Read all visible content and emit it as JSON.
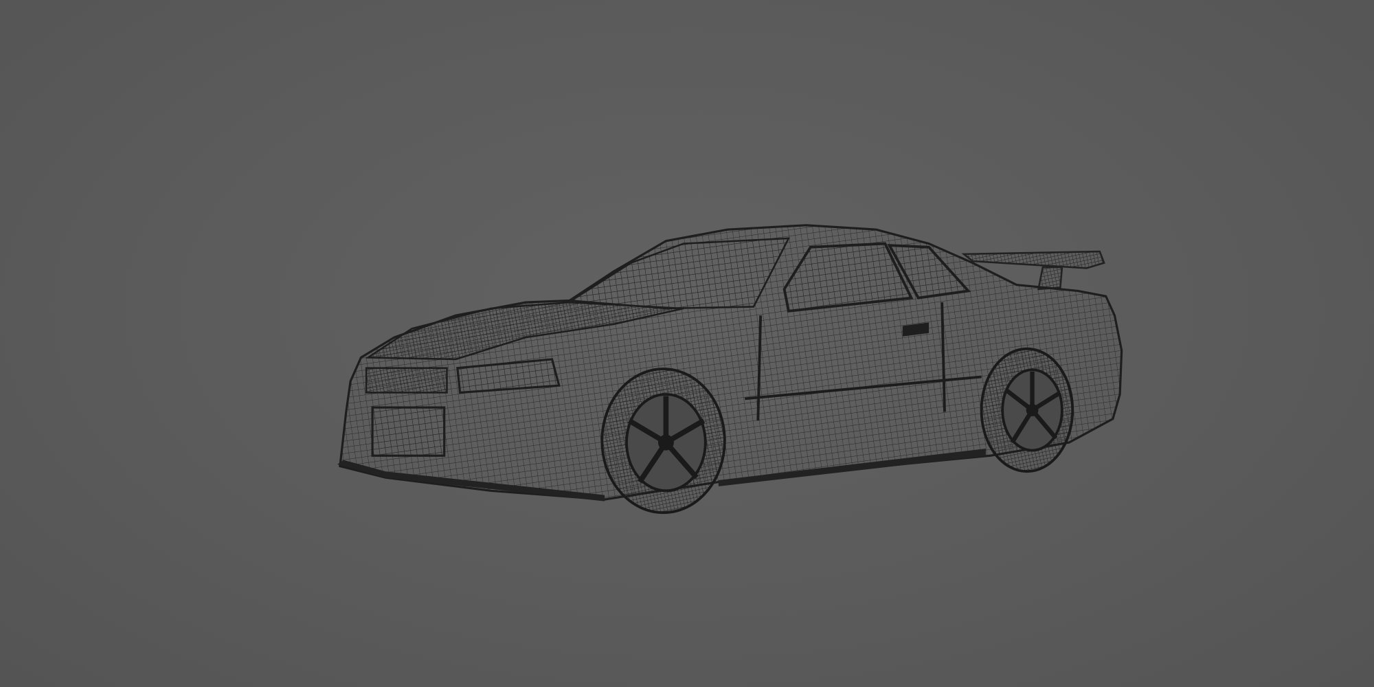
{
  "scene": {
    "subject": "car-wireframe-render",
    "background_color": "#5b5b5b",
    "wire_color": "#262626",
    "wire_dense_color": "#1a1a1a"
  }
}
